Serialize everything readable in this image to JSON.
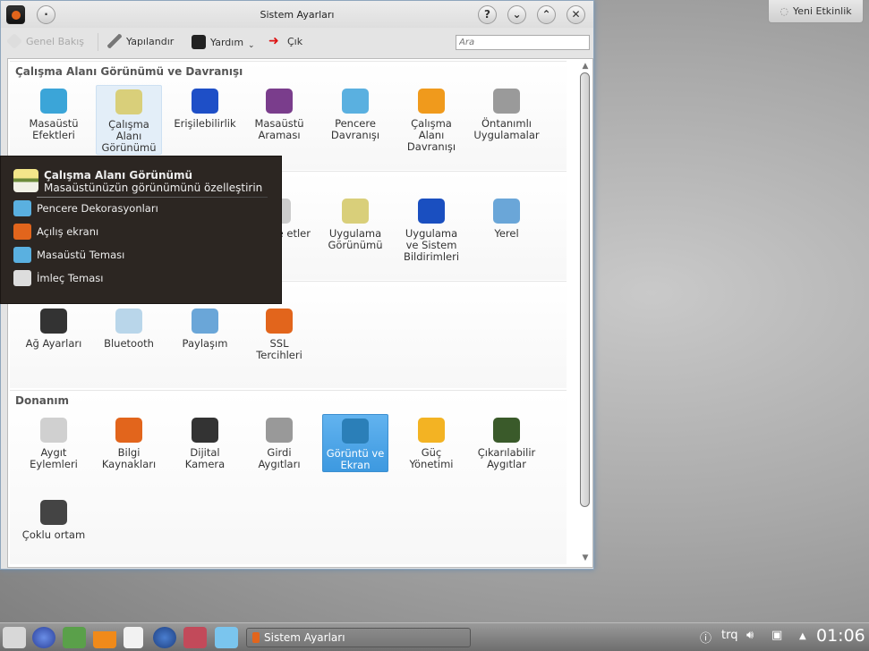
{
  "window": {
    "title": "Sistem Ayarları",
    "buttons": {
      "help": "?",
      "minimize": "⌄",
      "maximize": "⌃",
      "close": "✕"
    }
  },
  "toolbar": {
    "overview": "Genel Bakış",
    "configure": "Yapılandır",
    "help": "Yardım",
    "quit": "Çık",
    "search_placeholder": "Ara"
  },
  "sections": [
    {
      "title": "Çalışma Alanı Görünümü ve Davranışı",
      "items": [
        {
          "label": "Masaüstü Efektleri",
          "color": "#3ba5d8"
        },
        {
          "label": "Çalışma Alanı Görünümü",
          "color": "#d9cf7a",
          "state": "hover"
        },
        {
          "label": "Erişilebilirlik",
          "color": "#1e4fc7"
        },
        {
          "label": "Masaüstü Araması",
          "color": "#7a3d8c"
        },
        {
          "label": "Pencere Davranışı",
          "color": "#5ab0e0"
        },
        {
          "label": "Çalışma Alanı Davranışı",
          "color": "#f09a1c"
        },
        {
          "label": "Öntanımlı Uygulamalar",
          "color": "#9a9a9a"
        }
      ]
    },
    {
      "title": "",
      "items": [
        {
          "label": "ar ve etler",
          "color": "#cccccc"
        },
        {
          "label": "Uygulama Görünümü",
          "color": "#d9cf7a"
        },
        {
          "label": "Uygulama ve Sistem Bildirimleri",
          "color": "#1a4fc0"
        },
        {
          "label": "Yerel",
          "color": "#6aa6d8"
        }
      ]
    },
    {
      "title": "",
      "items": [
        {
          "label": "Ağ Ayarları",
          "color": "#333333"
        },
        {
          "label": "Bluetooth",
          "color": "#b9d6ea"
        },
        {
          "label": "Paylaşım",
          "color": "#6aa6d8"
        },
        {
          "label": "SSL Tercihleri",
          "color": "#e2651c"
        }
      ]
    },
    {
      "title": "Donanım",
      "items": [
        {
          "label": "Aygıt Eylemleri",
          "color": "#d0d0d0"
        },
        {
          "label": "Bilgi Kaynakları",
          "color": "#e2651c"
        },
        {
          "label": "Dijital Kamera",
          "color": "#333333"
        },
        {
          "label": "Girdi Aygıtları",
          "color": "#999999"
        },
        {
          "label": "Görüntü ve Ekran",
          "color": "#2b7fb8",
          "state": "selected"
        },
        {
          "label": "Güç Yönetimi",
          "color": "#f3b323"
        },
        {
          "label": "Çıkarılabilir Aygıtlar",
          "color": "#3a5a2a"
        },
        {
          "label": "Çoklu ortam",
          "color": "#444444"
        }
      ]
    }
  ],
  "popup": {
    "title": "Çalışma Alanı Görünümü",
    "subtitle": "Masaüstünüzün görünümünü özelleştirin",
    "items": [
      {
        "label": "Pencere Dekorasyonları",
        "color": "#5ab0e0"
      },
      {
        "label": "Açılış ekranı",
        "color": "#e2651c"
      },
      {
        "label": "Masaüstü Teması",
        "color": "#5ab0e0"
      },
      {
        "label": "İmleç Teması",
        "color": "#dddddd"
      }
    ]
  },
  "desktop": {
    "new_activity": "Yeni Etkinlik"
  },
  "taskbar": {
    "task": "Sistem Ayarları",
    "keyboard": "trq",
    "clock": "01:06"
  }
}
